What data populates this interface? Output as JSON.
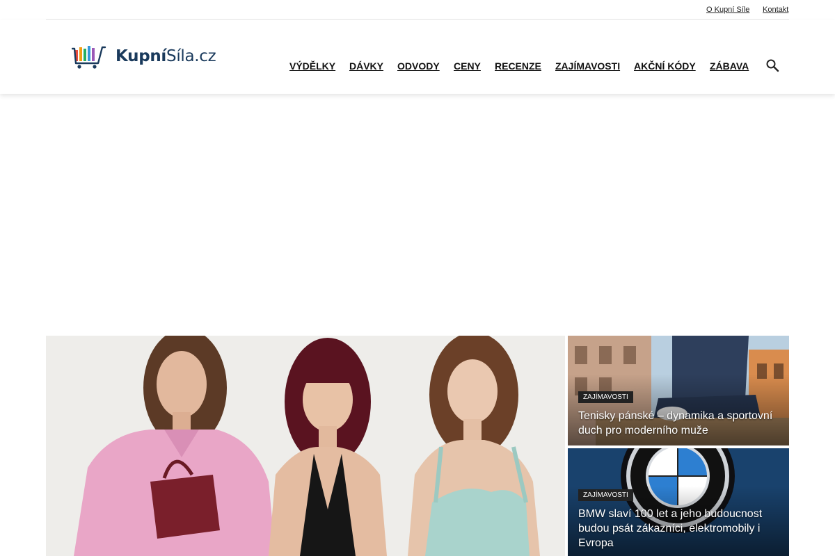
{
  "topbar": {
    "links": [
      "O Kupní Síle",
      "Kontakt"
    ]
  },
  "brand": {
    "name_bold": "Kupní",
    "name_rest": "Síla.cz",
    "colors": {
      "dark_blue": "#1a3a5c",
      "bar_red": "#e84c3d",
      "bar_orange": "#f39c12",
      "bar_green": "#27ae60",
      "bar_blue": "#3498db"
    }
  },
  "nav": {
    "items": [
      "VÝDĚLKY",
      "DÁVKY",
      "ODVODY",
      "CENY",
      "RECENZE",
      "ZAJÍMAVOSTI",
      "AKČNÍ KÓDY",
      "ZÁBAVA"
    ],
    "search_icon": "search-icon"
  },
  "featured": {
    "side_articles": [
      {
        "category": "ZAJÍMAVOSTI",
        "title": "Tenisky pánské – dynamika a sportovní duch pro moderního muže"
      },
      {
        "category": "ZAJÍMAVOSTI",
        "title": "BMW slaví 100 let a jeho budoucnost budou psát zákazníci, elektromobily i Evropa"
      }
    ]
  }
}
